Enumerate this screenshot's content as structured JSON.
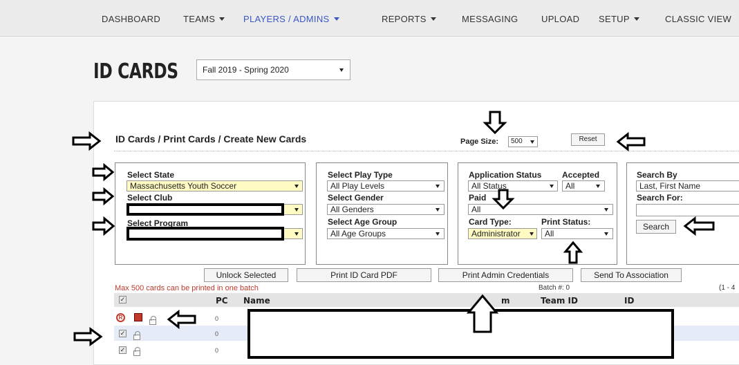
{
  "nav": {
    "items": [
      {
        "label": "DASHBOARD"
      },
      {
        "label": "TEAMS"
      },
      {
        "label": "PLAYERS / ADMINS"
      },
      {
        "label": "REPORTS"
      },
      {
        "label": "MESSAGING"
      },
      {
        "label": "UPLOAD"
      },
      {
        "label": "SETUP"
      },
      {
        "label": "CLASSIC VIEW"
      }
    ]
  },
  "header": {
    "title": "ID CARDS",
    "season": "Fall 2019 - Spring 2020"
  },
  "toolbar": {
    "breadcrumb": "ID Cards / Print Cards / Create New Cards",
    "page_size_label": "Page Size:",
    "page_size_value": "500",
    "reset_label": "Reset"
  },
  "filters": {
    "state_label": "Select State",
    "state_value": "Massachusetts Youth Soccer",
    "club_label": "Select Club",
    "program_label": "Select Program",
    "play_type_label": "Select Play Type",
    "play_type_value": "All Play Levels",
    "gender_label": "Select Gender",
    "gender_value": "All Genders",
    "age_group_label": "Select Age Group",
    "age_group_value": "All Age Groups",
    "app_status_label": "Application Status",
    "app_status_value": "All Status",
    "accepted_label": "Accepted",
    "accepted_value": "All",
    "paid_label": "Paid",
    "paid_value": "All",
    "card_type_label": "Card Type:",
    "card_type_value": "Administrator",
    "print_status_label": "Print Status:",
    "print_status_value": "All",
    "search_by_label": "Search By",
    "search_by_value": "Last, First Name",
    "search_for_label": "Search For:",
    "search_for_value": "",
    "search_button": "Search"
  },
  "actions": {
    "unlock": "Unlock Selected",
    "print_pdf": "Print ID Card PDF",
    "print_admin": "Print Admin Credentials",
    "send_assoc": "Send To Association"
  },
  "table": {
    "max_note": "Max 500 cards can be printed in one batch",
    "batch": "Batch #: 0",
    "range": "(1 - 4",
    "columns": {
      "pc": "PC",
      "name": "Name",
      "team": "m",
      "team_id": "Team ID",
      "id": "ID"
    },
    "rows": [
      {
        "pc": "0"
      },
      {
        "pc": "0"
      },
      {
        "pc": "0"
      }
    ]
  },
  "colors": {
    "nav_active": "#3a56c5",
    "warning": "#c0392b",
    "highlight_field": "#fffbc2"
  }
}
